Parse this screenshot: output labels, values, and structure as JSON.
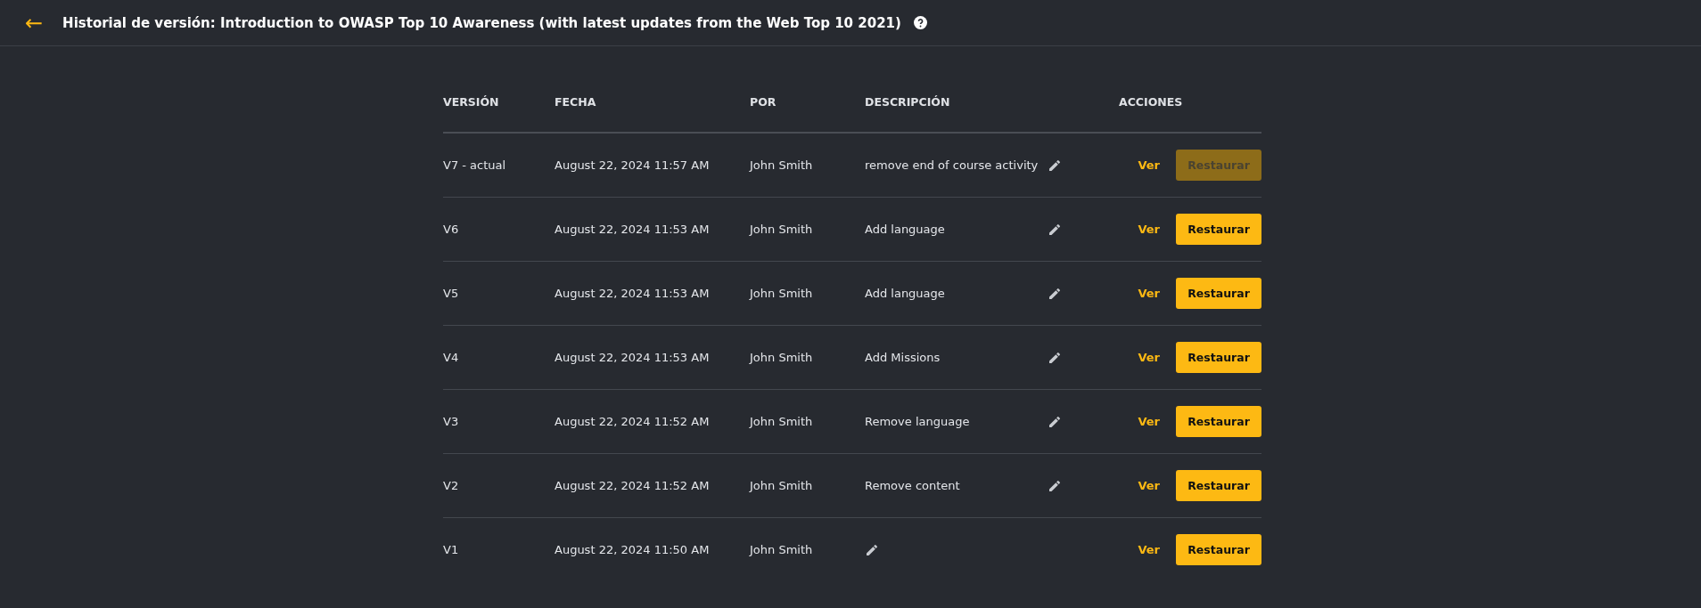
{
  "header": {
    "back_icon": "←",
    "title": "Historial de versión: Introduction to OWASP Top 10 Awareness (with latest updates from the Web Top 10 2021)"
  },
  "table": {
    "columns": [
      "VERSIÓN",
      "FECHA",
      "POR",
      "DESCRIPCIÓN",
      "ACCIONES"
    ],
    "rows": [
      {
        "version": "V7 - actual",
        "date": "August 22, 2024 11:57 AM",
        "by": "John Smith",
        "description": "remove end of course activity",
        "view": "Ver",
        "restore": {
          "label": "Restaurar",
          "disabled": true
        }
      },
      {
        "version": "V6",
        "date": "August 22, 2024 11:53 AM",
        "by": "John Smith",
        "description": "Add language",
        "view": "Ver",
        "restore": {
          "label": "Restaurar",
          "disabled": false
        }
      },
      {
        "version": "V5",
        "date": "August 22, 2024 11:53 AM",
        "by": "John Smith",
        "description": "Add language",
        "view": "Ver",
        "restore": {
          "label": "Restaurar",
          "disabled": false
        }
      },
      {
        "version": "V4",
        "date": "August 22, 2024 11:53 AM",
        "by": "John Smith",
        "description": "Add Missions",
        "view": "Ver",
        "restore": {
          "label": "Restaurar",
          "disabled": false
        }
      },
      {
        "version": "V3",
        "date": "August 22, 2024 11:52 AM",
        "by": "John Smith",
        "description": "Remove language",
        "view": "Ver",
        "restore": {
          "label": "Restaurar",
          "disabled": false
        }
      },
      {
        "version": "V2",
        "date": "August 22, 2024 11:52 AM",
        "by": "John Smith",
        "description": "Remove content",
        "view": "Ver",
        "restore": {
          "label": "Restaurar",
          "disabled": false
        }
      },
      {
        "version": "V1",
        "date": "August 22, 2024 11:50 AM",
        "by": "John Smith",
        "view": "Ver",
        "restore": {
          "label": "Restaurar",
          "disabled": false
        }
      }
    ]
  }
}
